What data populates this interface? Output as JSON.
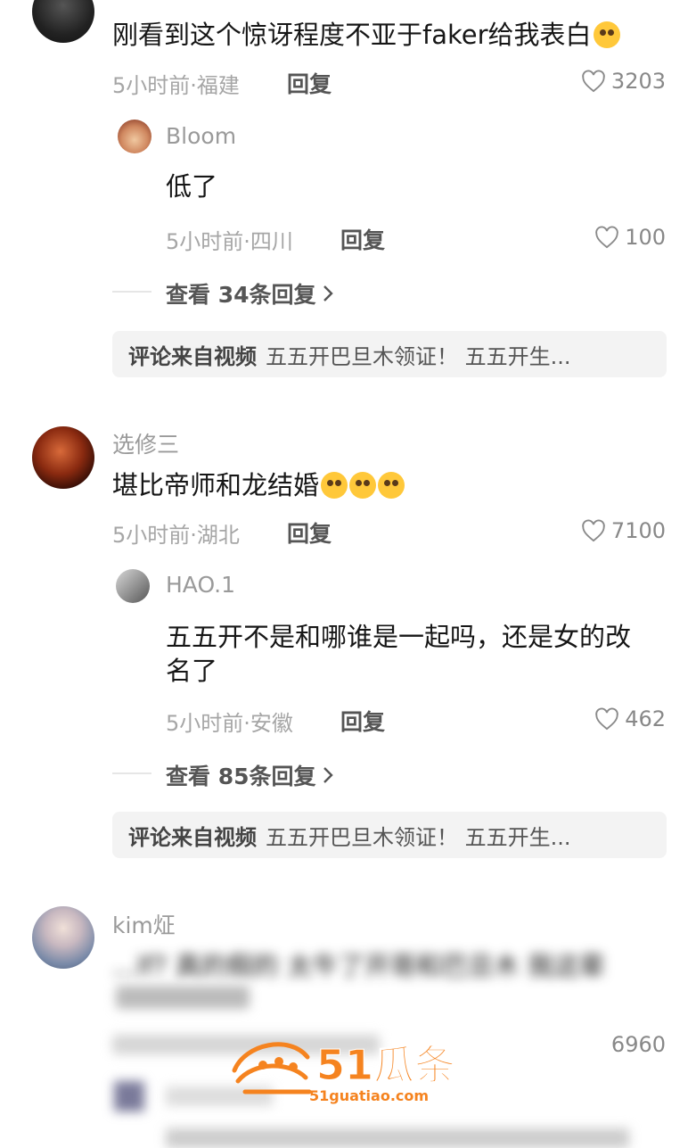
{
  "comments": [
    {
      "text": "刚看到这个惊讶程度不亚于faker给我表白",
      "meta": "5小时前·福建",
      "reply": "回复",
      "likes": "3203",
      "sub": {
        "user": "Bloom",
        "text": "低了",
        "meta": "5小时前·四川",
        "reply": "回复",
        "likes": "100"
      },
      "more": "查看 34条回复",
      "source_label": "评论来自视频",
      "source_text": "五五开巴旦木领证！ 五五开生..."
    },
    {
      "user": "选修三",
      "text": "堪比帝师和龙结婚",
      "meta": "5小时前·湖北",
      "reply": "回复",
      "likes": "7100",
      "sub": {
        "user": "HAO.1",
        "text_line1": "五五开不是和哪谁是一起吗，还是女的改",
        "text_line2": "名了",
        "meta": "5小时前·安徽",
        "reply": "回复",
        "likes": "462"
      },
      "more": "查看 85条回复",
      "source_label": "评论来自视频",
      "source_text": "五五开巴旦木领证！ 五五开生..."
    },
    {
      "user": "kim炡",
      "text": "...lf? 真的假的 太牛了开哥和巴旦木 我这辈",
      "likes": "6960"
    }
  ],
  "watermark": {
    "brand": "51瓜条",
    "url": "51guatiao.com"
  }
}
